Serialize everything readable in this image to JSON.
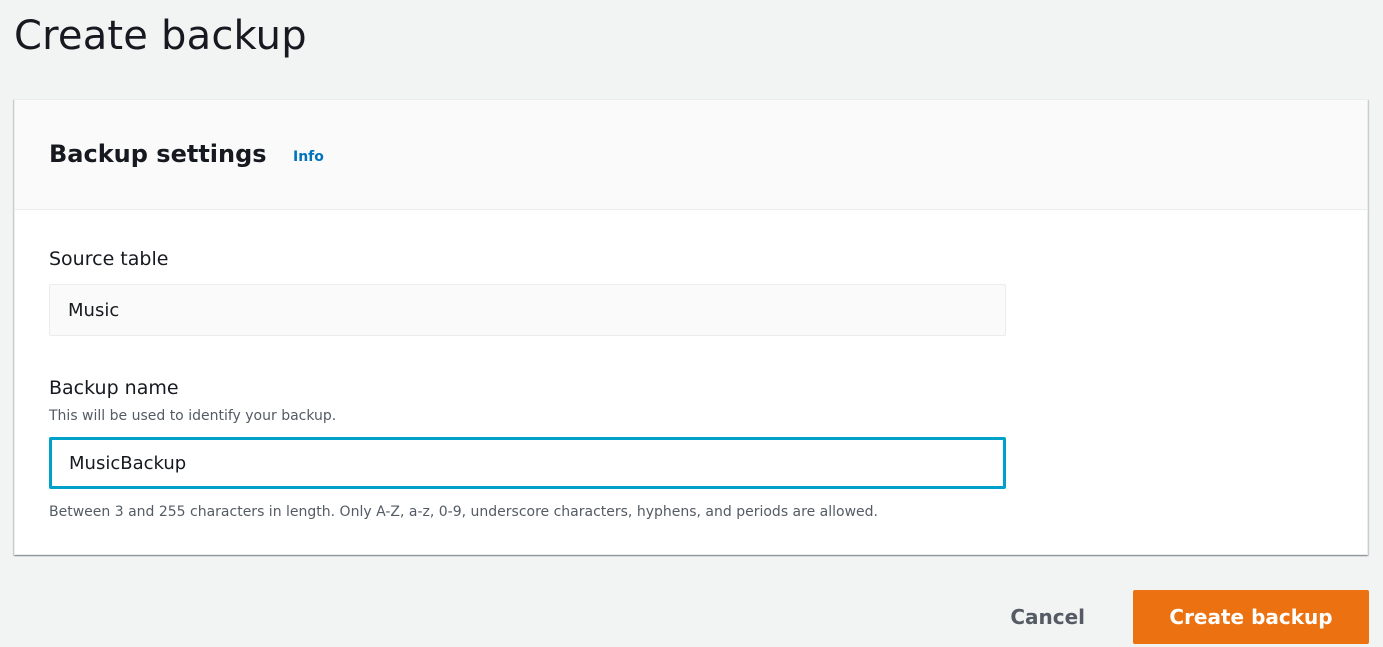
{
  "page": {
    "title": "Create backup"
  },
  "backup_settings": {
    "title": "Backup settings",
    "info_link": "Info",
    "source_table": {
      "label": "Source table",
      "value": "Music"
    },
    "backup_name": {
      "label": "Backup name",
      "description": "This will be used to identify your backup.",
      "value": "MusicBackup",
      "constraint": "Between 3 and 255 characters in length. Only A-Z, a-z, 0-9, underscore characters, hyphens, and periods are allowed."
    }
  },
  "actions": {
    "cancel_label": "Cancel",
    "create_label": "Create backup"
  },
  "colors": {
    "primary_button": "#ec7211",
    "link": "#0073bb",
    "focus_border": "#00a1c9",
    "background": "#f2f3f3"
  }
}
